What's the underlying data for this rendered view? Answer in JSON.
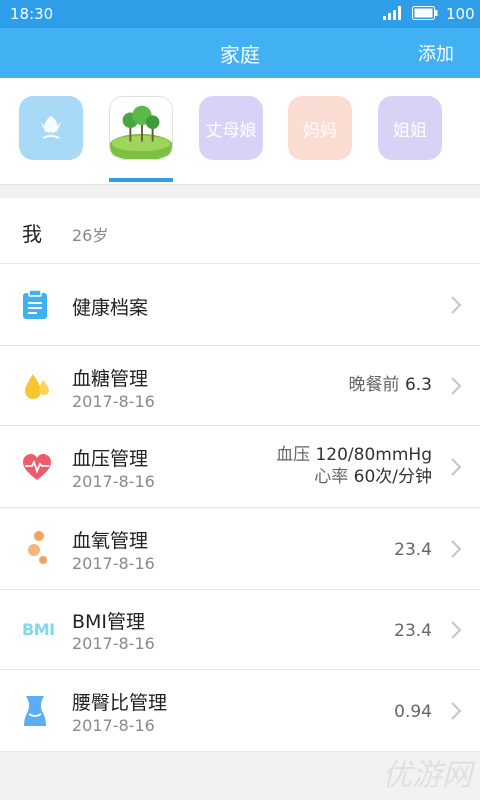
{
  "status_bar": {
    "time": "18:30",
    "battery": "100"
  },
  "header": {
    "title": "家庭",
    "add_label": "添加"
  },
  "members": [
    {
      "label": "",
      "icon": "tulip-icon"
    },
    {
      "label": "",
      "icon": "tree-landscape-icon"
    },
    {
      "label": "丈母娘"
    },
    {
      "label": "妈妈"
    },
    {
      "label": "姐姐"
    }
  ],
  "me": {
    "label": "我",
    "age": "26岁"
  },
  "records": {
    "archive": {
      "label": "健康档案",
      "icon": "document-icon"
    },
    "sugar": {
      "label": "血糖管理",
      "date": "2017-8-16",
      "value_prefix": "晚餐前",
      "value": "6.3",
      "icon": "water-drop-icon"
    },
    "pressure": {
      "label": "血压管理",
      "date": "2017-8-16",
      "bp_prefix": "血压",
      "bp_value": "120/80mmHg",
      "hr_prefix": "心率",
      "hr_value": "60次/分钟",
      "icon": "heart-pulse-icon"
    },
    "oxygen": {
      "label": "血氧管理",
      "date": "2017-8-16",
      "value": "23.4",
      "icon": "bubbles-icon"
    },
    "bmi": {
      "label": "BMI管理",
      "date": "2017-8-16",
      "value": "23.4",
      "icon_text": "BMI"
    },
    "waist": {
      "label": "腰臀比管理",
      "date": "2017-8-16",
      "value": "0.94",
      "icon": "waist-icon"
    }
  },
  "watermark": "优游网",
  "colors": {
    "primary": "#41b1f4",
    "status_bar": "#2e9ee8",
    "accent_orange": "#f5a25d",
    "accent_red": "#ef5b6b",
    "accent_yellow": "#f7c52e"
  }
}
